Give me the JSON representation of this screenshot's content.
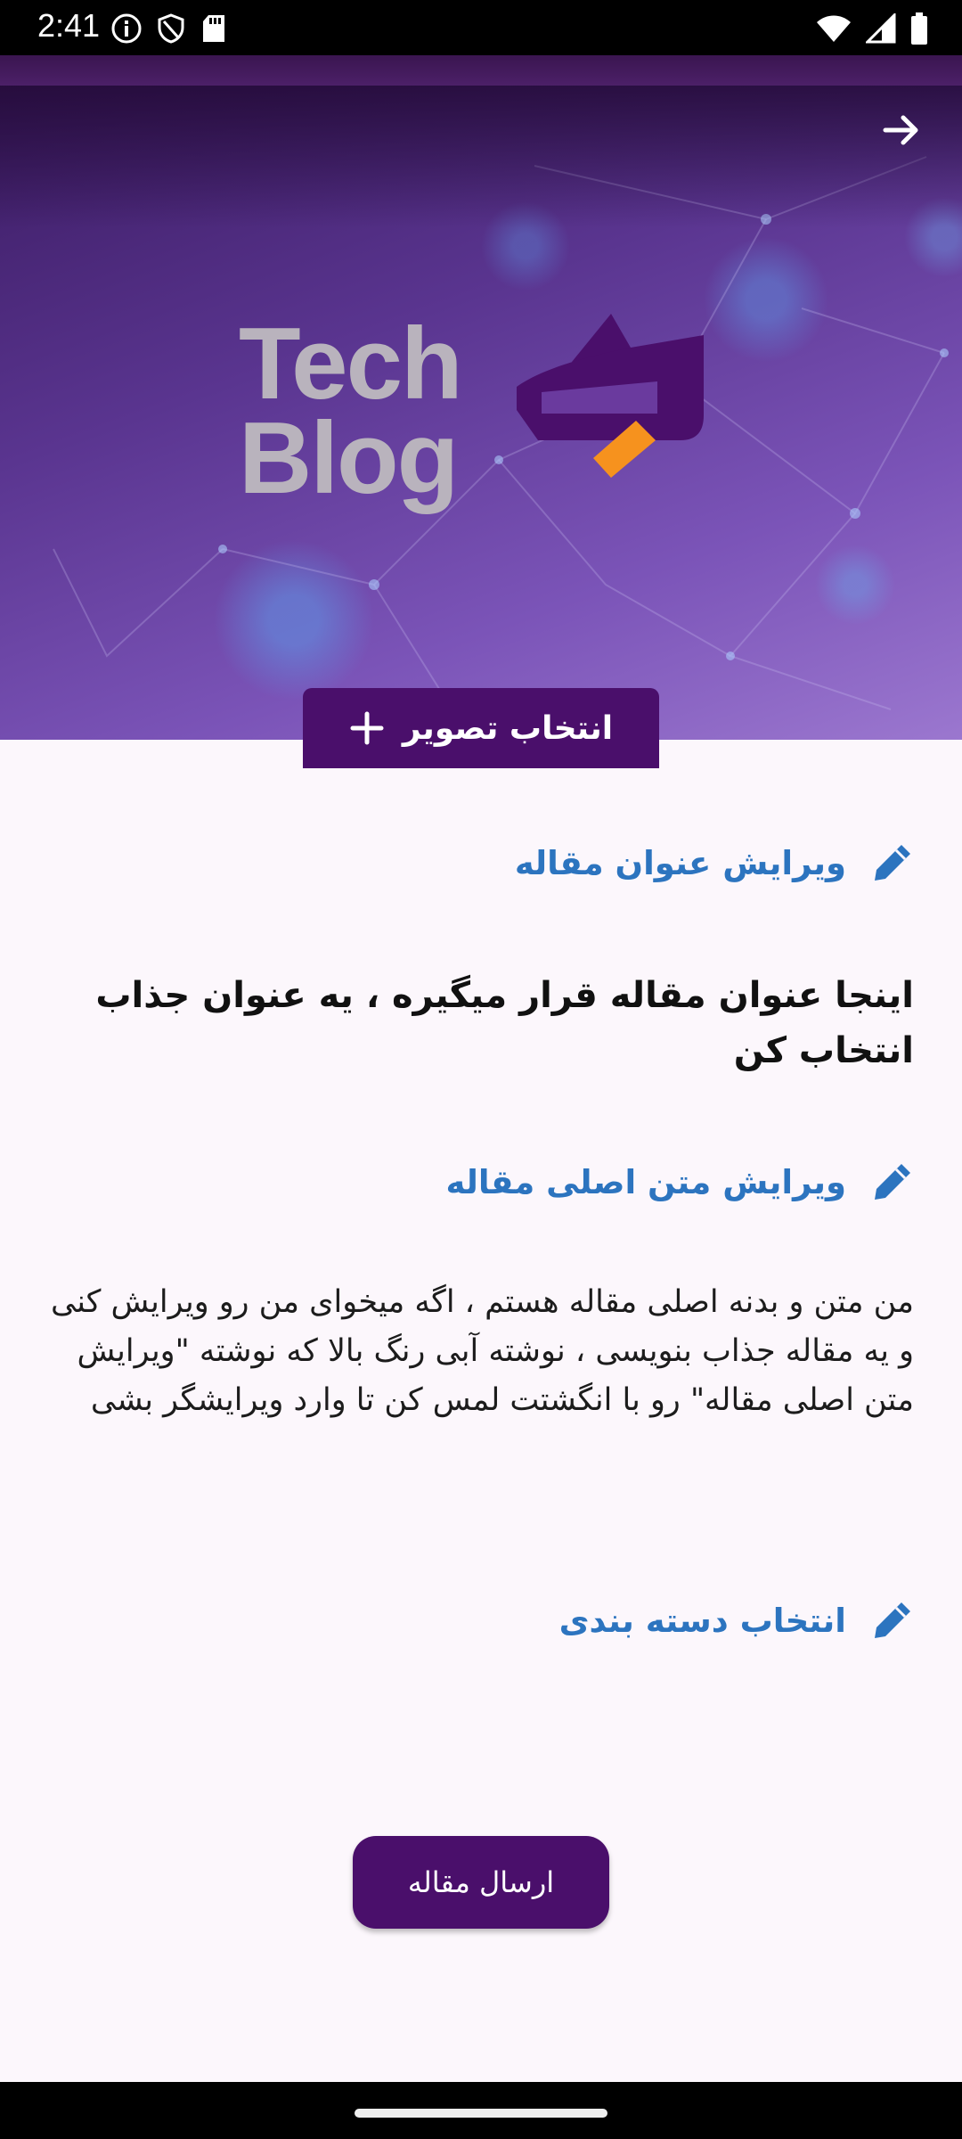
{
  "status_bar": {
    "time": "2:41",
    "left_icons": [
      "info-icon",
      "shield-icon",
      "sd-card-icon"
    ],
    "right_icons": [
      "wifi-icon",
      "signal-icon",
      "battery-icon"
    ]
  },
  "header": {
    "back_icon": "arrow-right-icon",
    "logo_line1": "Tech",
    "logo_line2": "Blog"
  },
  "hero": {
    "pick_image_label": "انتخاب تصویر",
    "pick_image_icon": "plus-icon"
  },
  "sections": {
    "edit_title_label": "ویرایش عنوان مقاله",
    "article_title": "اینجا عنوان مقاله قرار میگیره ، یه عنوان جذاب انتخاب کن",
    "edit_body_label": "ویرایش متن اصلی مقاله",
    "article_body": "من متن و بدنه اصلی مقاله هستم ، اگه میخوای من رو ویرایش کنی و یه مقاله جذاب بنویسی ، نوشته آبی رنگ بالا که نوشته \"ویرایش متن اصلی مقاله\" رو با انگشتت لمس کن تا وارد ویرایشگر بشی",
    "pick_category_label": "انتخاب دسته بندی",
    "edit_icon": "pencil-icon"
  },
  "actions": {
    "submit_label": "ارسال مقاله"
  },
  "colors": {
    "primary": "#4a0f6b",
    "link_blue": "#2c74bf",
    "accent_orange": "#f6921e",
    "background": "#fcf7fc"
  }
}
